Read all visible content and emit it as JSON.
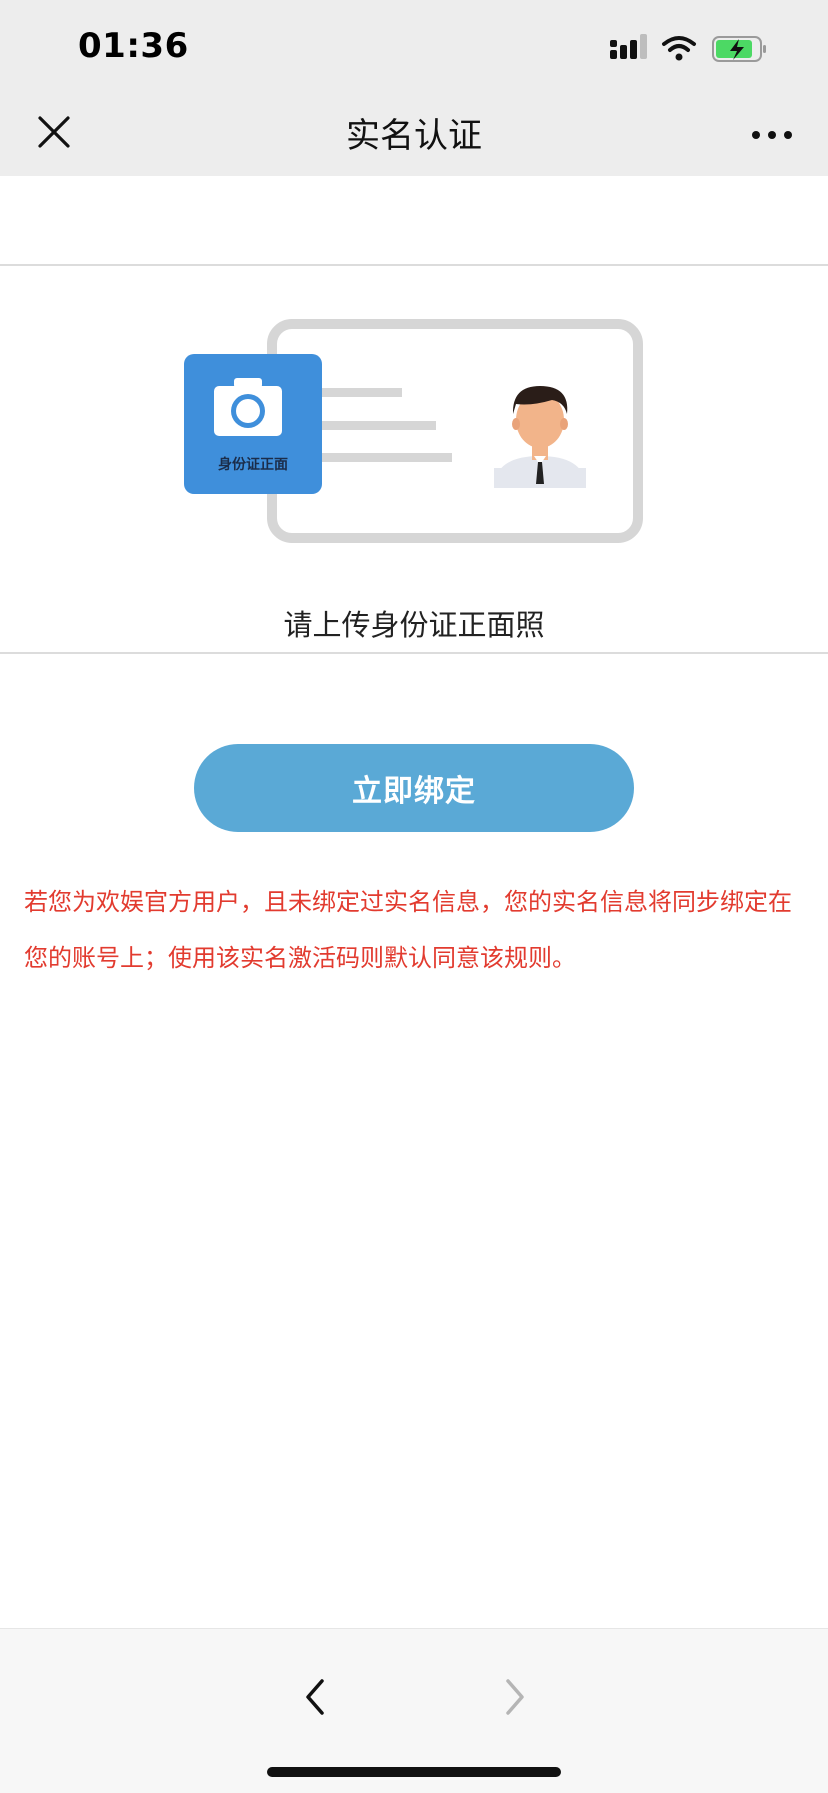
{
  "status_bar": {
    "time": "01:36"
  },
  "nav": {
    "title": "实名认证"
  },
  "upload": {
    "card_label": "身份证正面",
    "hint": "请上传身份证正面照"
  },
  "actions": {
    "bind_label": "立即绑定"
  },
  "notice": {
    "text": "若您为欢娱官方用户，且未绑定过实名信息，您的实名信息将同步绑定在您的账号上；使用该实名激活码则默认同意该规则。"
  },
  "colors": {
    "accent": "#5aa9d6",
    "notice_red": "#e23b2f",
    "camera_blue": "#3f8fdb"
  }
}
